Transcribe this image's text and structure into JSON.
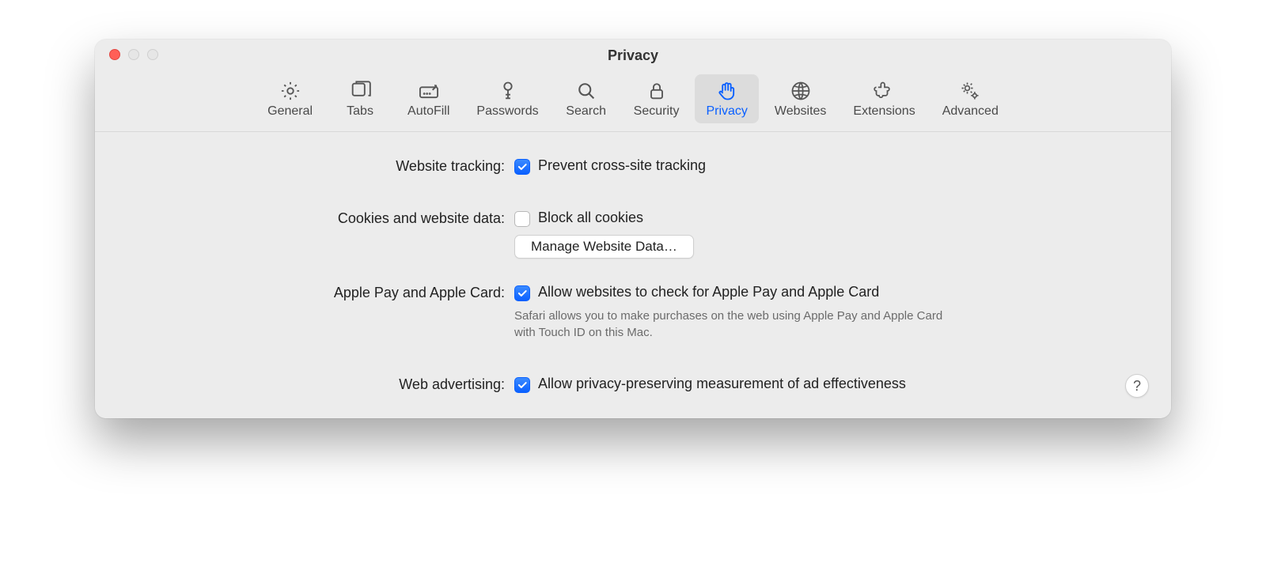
{
  "window": {
    "title": "Privacy"
  },
  "tabs": [
    {
      "id": "general",
      "label": "General"
    },
    {
      "id": "tabs",
      "label": "Tabs"
    },
    {
      "id": "autofill",
      "label": "AutoFill"
    },
    {
      "id": "passwords",
      "label": "Passwords"
    },
    {
      "id": "search",
      "label": "Search"
    },
    {
      "id": "security",
      "label": "Security"
    },
    {
      "id": "privacy",
      "label": "Privacy",
      "selected": true
    },
    {
      "id": "websites",
      "label": "Websites"
    },
    {
      "id": "extensions",
      "label": "Extensions"
    },
    {
      "id": "advanced",
      "label": "Advanced"
    }
  ],
  "sections": {
    "tracking": {
      "label": "Website tracking:",
      "checkbox_label": "Prevent cross-site tracking",
      "checked": true
    },
    "cookies": {
      "label": "Cookies and website data:",
      "checkbox_label": "Block all cookies",
      "checked": false,
      "button": "Manage Website Data…"
    },
    "applepay": {
      "label": "Apple Pay and Apple Card:",
      "checkbox_label": "Allow websites to check for Apple Pay and Apple Card",
      "checked": true,
      "description": "Safari allows you to make purchases on the web using Apple Pay and Apple Card with Touch ID on this Mac."
    },
    "ads": {
      "label": "Web advertising:",
      "checkbox_label": "Allow privacy-preserving measurement of ad effectiveness",
      "checked": true
    }
  },
  "help": {
    "label": "?"
  }
}
